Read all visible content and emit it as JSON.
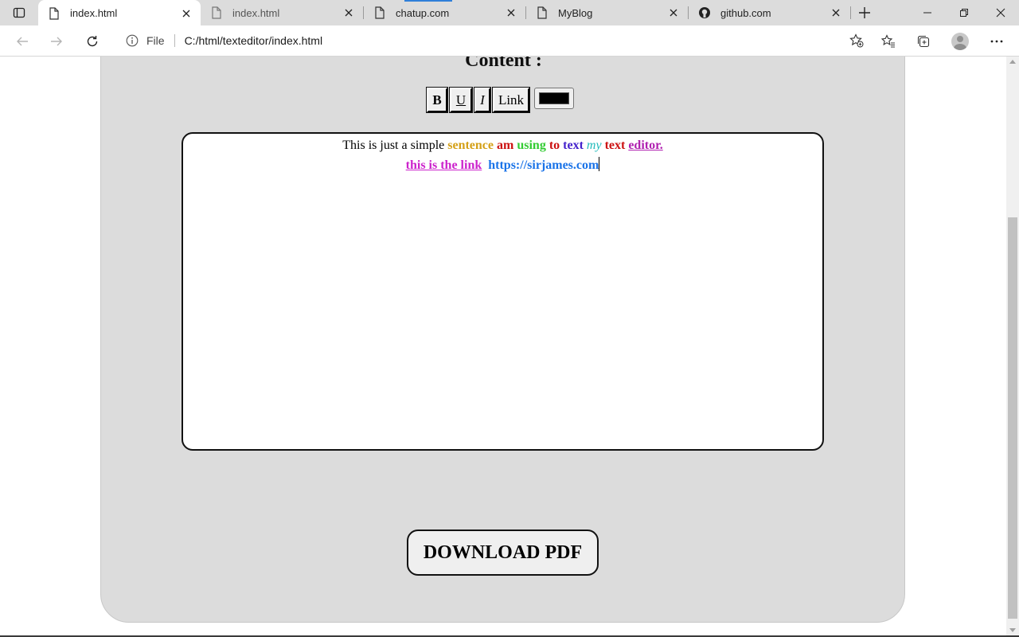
{
  "browser": {
    "tabs": [
      {
        "title": "index.html",
        "active": true
      },
      {
        "title": "index.html",
        "active": false
      },
      {
        "title": "chatup.com",
        "active": false
      },
      {
        "title": "MyBlog",
        "active": false
      },
      {
        "title": "github.com",
        "active": false
      }
    ],
    "address": {
      "scheme_label": "File",
      "url": "C:/html/texteditor/index.html"
    }
  },
  "page": {
    "heading": "Content :",
    "toolbar": {
      "bold_label": "B",
      "underline_label": "U",
      "italic_label": "I",
      "link_label": "Link",
      "color_value": "#000000"
    },
    "editor": {
      "line1": [
        {
          "text": "This is just a simple ",
          "color": "#000000",
          "bold": false
        },
        {
          "text": "sentence",
          "color": "#d4a017",
          "bold": true
        },
        {
          "text": "am",
          "color": "#cc1111",
          "bold": true
        },
        {
          "text": "using",
          "color": "#33cc33",
          "bold": true
        },
        {
          "text": "to",
          "color": "#cc1111",
          "bold": true
        },
        {
          "text": "text",
          "color": "#4422cc",
          "bold": true
        },
        {
          "text": "my",
          "color": "#22bbbb",
          "italic": true
        },
        {
          "text": "text",
          "color": "#cc1111",
          "bold": true
        },
        {
          "text": "editor.",
          "color": "#b020b0",
          "bold": true,
          "underline": true
        }
      ],
      "line2": [
        {
          "text": "this is the link",
          "color": "#cc22cc",
          "bold": true,
          "underline": true
        },
        {
          "text": "https://sirjames.com",
          "color": "#1a73e8",
          "bold": true
        }
      ]
    },
    "download_label": "DOWNLOAD PDF"
  }
}
